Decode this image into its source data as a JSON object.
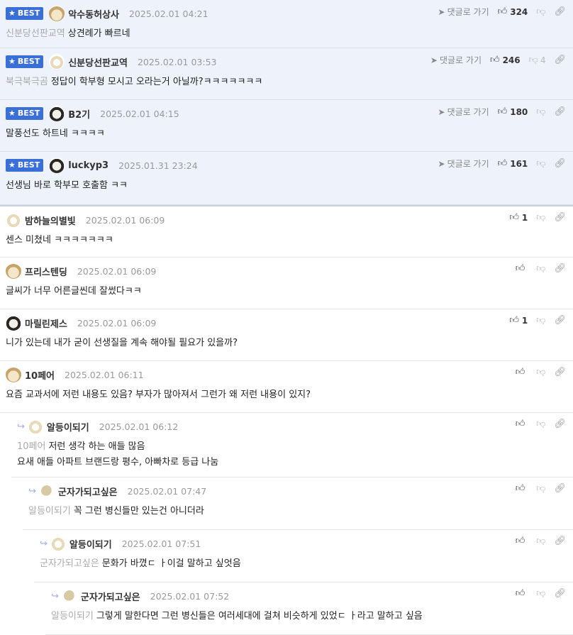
{
  "best_label": "BEST",
  "reply_label": "댓글로 가기",
  "comments": [
    {
      "best": true,
      "nick": "악수동허상사",
      "date": "2025.02.01 04:21",
      "mention": "신분당선판교역",
      "text": "상견례가 빠르네",
      "likes": "324",
      "dislikes": "",
      "avatar": "dog"
    },
    {
      "best": true,
      "nick": "신분당선판교역",
      "date": "2025.02.01 03:53",
      "mention": "북극북극곰",
      "text": "정답이 학부형 모시고 오라는거 아닐까?ㅋㅋㅋㅋㅋㅋㅋ",
      "likes": "246",
      "dislikes": "4",
      "avatar": "dog2"
    },
    {
      "best": true,
      "nick": "B2기",
      "date": "2025.02.01 04:15",
      "mention": "",
      "text": "말풍선도 하트네 ㅋㅋㅋㅋ",
      "likes": "180",
      "dislikes": "",
      "avatar": "bear"
    },
    {
      "best": true,
      "nick": "luckyp3",
      "date": "2025.01.31 23:24",
      "mention": "",
      "text": "선생님 바로 학부모 호출함 ㅋㅋ",
      "likes": "161",
      "dislikes": "",
      "avatar": "bear"
    },
    {
      "best": false,
      "nick": "밤하늘의별빛",
      "date": "2025.02.01 06:09",
      "mention": "",
      "text": "센스 미쳤네 ㅋㅋㅋㅋㅋㅋㅋ",
      "likes": "1",
      "dislikes": "",
      "avatar": "dog2"
    },
    {
      "best": false,
      "nick": "프리스텐딩",
      "date": "2025.02.01 06:09",
      "mention": "",
      "text": "글씨가 너무 어른글씬데 잘썼다ㅋㅋ",
      "likes": "",
      "dislikes": "",
      "avatar": "dog"
    },
    {
      "best": false,
      "nick": "마릴린제스",
      "date": "2025.02.01 06:09",
      "mention": "",
      "text": "니가 있는데 내가 굳이 선생질을 계속 해야될 필요가 있을까?",
      "likes": "1",
      "dislikes": "",
      "avatar": "bear"
    },
    {
      "best": false,
      "nick": "10페어",
      "date": "2025.02.01 06:11",
      "mention": "",
      "text": "요즘 교과서에 저런 내용도 있음? 부자가 많아져서 그런가 왜 저런 내용이 있지?",
      "likes": "",
      "dislikes": "",
      "avatar": "dog"
    },
    {
      "best": false,
      "depth": 1,
      "nick": "알등이되기",
      "date": "2025.02.01 06:12",
      "mention": "10페어",
      "text": "저런 생각 하는 애들 많음",
      "text2": "요새 애들 아파트 브랜드랑 평수, 아빠차로 등급 나눔",
      "likes": "",
      "dislikes": "",
      "avatar": "dog2"
    },
    {
      "best": false,
      "depth": 2,
      "nick": "군자가되고싶은",
      "date": "2025.02.01 07:47",
      "mention": "알등이되기",
      "text": "꼭 그런 병신들만 있는건 아니더라",
      "likes": "",
      "dislikes": "",
      "avatar": "ball"
    },
    {
      "best": false,
      "depth": 3,
      "nick": "알등이되기",
      "date": "2025.02.01 07:51",
      "mention": "군자가되고싶은",
      "text": "문화가 바꼈ㄷ ㅏ이걸 말하고 싶엇음",
      "likes": "",
      "dislikes": "",
      "avatar": "dog2"
    },
    {
      "best": false,
      "depth": 4,
      "nick": "군자가되고싶은",
      "date": "2025.02.01 07:52",
      "mention": "알등이되기",
      "text": "그렇게 말한다면 그런 병신들은 여러세대에 걸쳐 비슷하게 있었ㄷ ㅏ라고 말하고 싶음",
      "likes": "",
      "dislikes": "",
      "avatar": "ball"
    }
  ],
  "icons": {
    "best": "star-icon",
    "reply": "send-icon",
    "like": "thumbs-up-icon",
    "dislike": "thumbs-down-icon",
    "link": "link-icon",
    "reply_arrow": "reply-arrow-icon"
  }
}
